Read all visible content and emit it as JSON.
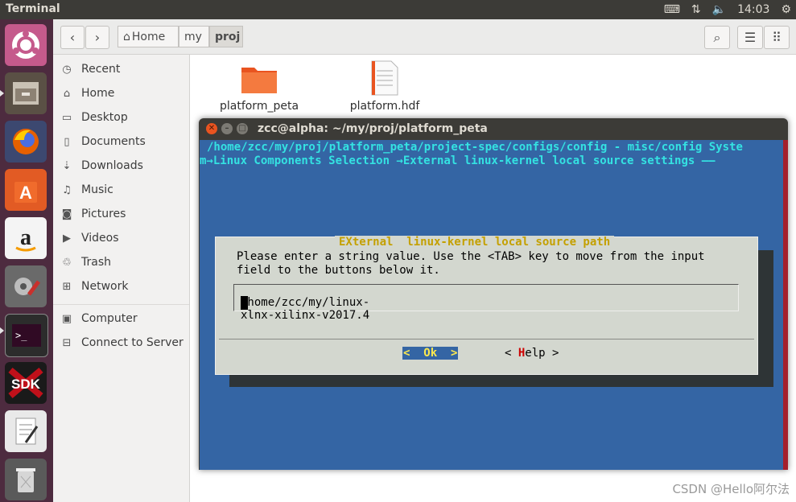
{
  "topbar": {
    "app_name": "Terminal",
    "time": "14:03"
  },
  "files": {
    "breadcrumbs": [
      "Home",
      "my",
      "proj"
    ],
    "sidebar": [
      {
        "label": "Recent",
        "icon": "clock-icon",
        "glyph": "◷"
      },
      {
        "label": "Home",
        "icon": "home-icon",
        "glyph": "⌂"
      },
      {
        "label": "Desktop",
        "icon": "desktop-icon",
        "glyph": "▭"
      },
      {
        "label": "Documents",
        "icon": "document-icon",
        "glyph": "▯"
      },
      {
        "label": "Downloads",
        "icon": "download-icon",
        "glyph": "⇣"
      },
      {
        "label": "Music",
        "icon": "music-icon",
        "glyph": "♫"
      },
      {
        "label": "Pictures",
        "icon": "camera-icon",
        "glyph": "◙"
      },
      {
        "label": "Videos",
        "icon": "video-icon",
        "glyph": "▶"
      },
      {
        "label": "Trash",
        "icon": "trash-icon",
        "glyph": "♲"
      },
      {
        "label": "Network",
        "icon": "network-icon",
        "glyph": "⊞"
      },
      {
        "label": "Computer",
        "icon": "computer-icon",
        "glyph": "▣"
      },
      {
        "label": "Connect to Server",
        "icon": "server-icon",
        "glyph": "⊟"
      }
    ],
    "items": [
      {
        "name": "platform_peta"
      },
      {
        "name": "platform.hdf"
      }
    ]
  },
  "terminal": {
    "title": "zcc@alpha: ~/my/proj/platform_peta",
    "line1": "/home/zcc/my/proj/platform_peta/project-spec/configs/config - misc/config Syste",
    "line2": "m→Linux Components Selection →External linux-kernel local source settings ——",
    "dialog": {
      "title": "EXternal  linux-kernel local source path",
      "prompt": "Please enter a string value. Use the <TAB> key to move from the input\nfield to the buttons below it.",
      "value": "/home/zcc/my/linux-xlnx-xilinx-v2017.4",
      "ok": "<  Ok  >",
      "help_pre": "< ",
      "help_hot": "H",
      "help_post": "elp >"
    }
  },
  "watermark": "CSDN @Hello阿尔法"
}
